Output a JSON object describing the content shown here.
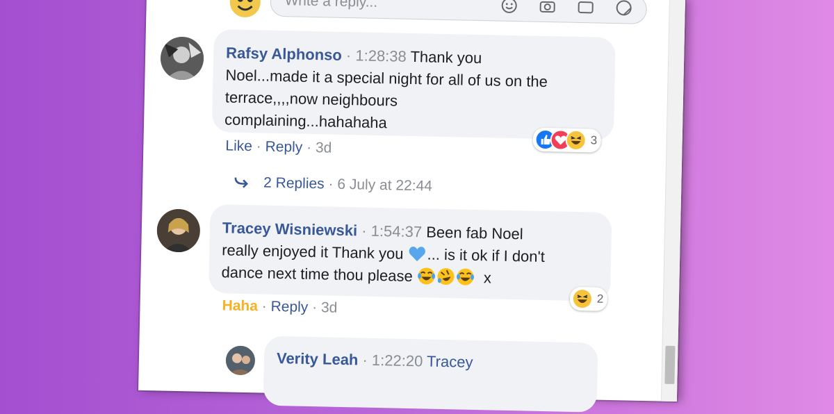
{
  "reply_box": {
    "placeholder": "Write a reply..."
  },
  "comments": [
    {
      "author": "Rafsy Alphonso",
      "timestamp": "1:28:38",
      "text_line1": "Thank you",
      "text_line2": "Noel...made it a special night for all of us on the",
      "text_line3": "terrace,,,,now neighbours",
      "text_line4": "complaining...hahahaha",
      "reactions": [
        "like",
        "love",
        "haha"
      ],
      "reaction_count": "3",
      "like_label": "Like",
      "reply_label": "Reply",
      "age": "3d",
      "replies_label": "2 Replies",
      "replies_date": "6 July at 22:44"
    },
    {
      "author": "Tracey Wisniewski",
      "timestamp": "1:54:37",
      "text_line1": "Been fab Noel",
      "text_line2a": "really enjoyed it Thank you",
      "text_line2b": "... is it ok if I don't",
      "text_line3a": "dance next time thou please",
      "text_line3b": "x",
      "inline_emojis": [
        "blue-heart",
        "joy",
        "rofl",
        "joy"
      ],
      "reactions": [
        "haha"
      ],
      "reaction_count": "2",
      "like_label": "Haha",
      "reply_label": "Reply",
      "age": "3d"
    },
    {
      "author": "Verity Leah",
      "timestamp": "1:22:20",
      "text_line1": "Tracey"
    }
  ],
  "separator": "·"
}
